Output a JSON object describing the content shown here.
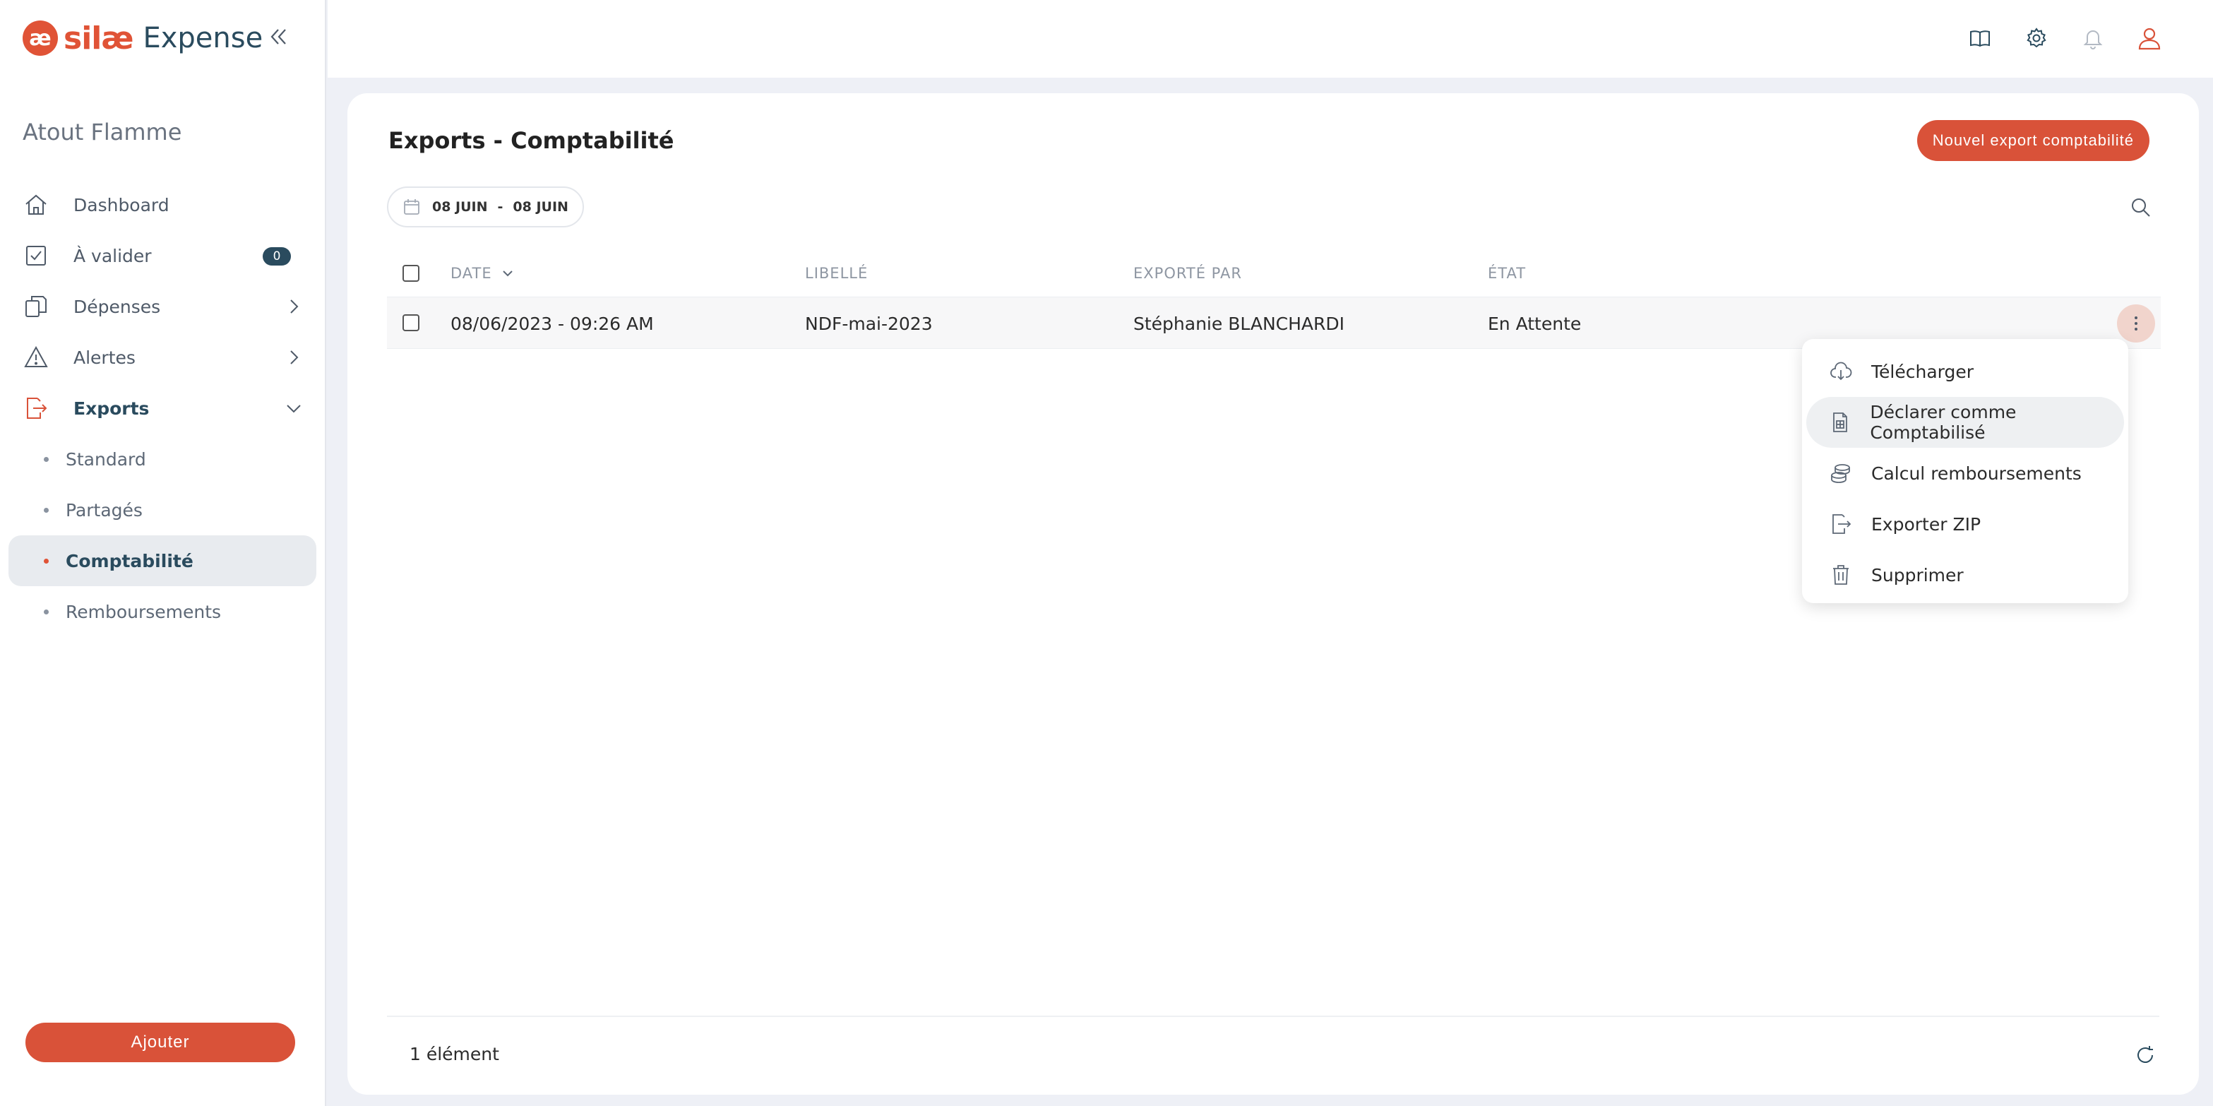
{
  "brand": {
    "mark": "æ",
    "name": "silæ",
    "product": "Expense"
  },
  "company": "Atout Flamme",
  "nav": {
    "dashboard": "Dashboard",
    "a_valider": "À valider",
    "a_valider_count": "0",
    "depenses": "Dépenses",
    "alertes": "Alertes",
    "exports": "Exports",
    "sub": [
      "Standard",
      "Partagés",
      "Comptabilité",
      "Remboursements"
    ]
  },
  "add_label": "Ajouter",
  "page": {
    "title": "Exports - Comptabilité",
    "new_export_label": "Nouvel export comptabilité",
    "date_from": "08 JUIN",
    "date_sep": "-",
    "date_to": "08 JUIN"
  },
  "table": {
    "headers": {
      "date": "DATE",
      "libelle": "LIBELLÉ",
      "exporte_par": "EXPORTÉ PAR",
      "etat": "ÉTAT"
    },
    "rows": [
      {
        "date": "08/06/2023 - 09:26 AM",
        "libelle": "NDF-mai-2023",
        "exporte_par": "Stéphanie BLANCHARDI",
        "etat": "En Attente"
      }
    ]
  },
  "menu": [
    "Télécharger",
    "Déclarer comme Comptabilisé",
    "Calcul remboursements",
    "Exporter ZIP",
    "Supprimer"
  ],
  "footer": {
    "count": "1 élément"
  },
  "colors": {
    "accent": "#d95239",
    "brand_dark": "#2a4b5e",
    "background": "#eef0f6"
  },
  "icons": [
    "collapse-icon",
    "book-icon",
    "gear-icon",
    "bell-icon",
    "user-icon",
    "home-icon",
    "check-square-icon",
    "copy-icon",
    "warning-icon",
    "export-icon",
    "calendar-icon",
    "search-icon",
    "more-vertical-icon",
    "cloud-download-icon",
    "document-icon",
    "coins-icon",
    "file-export-icon",
    "trash-icon",
    "refresh-icon"
  ]
}
